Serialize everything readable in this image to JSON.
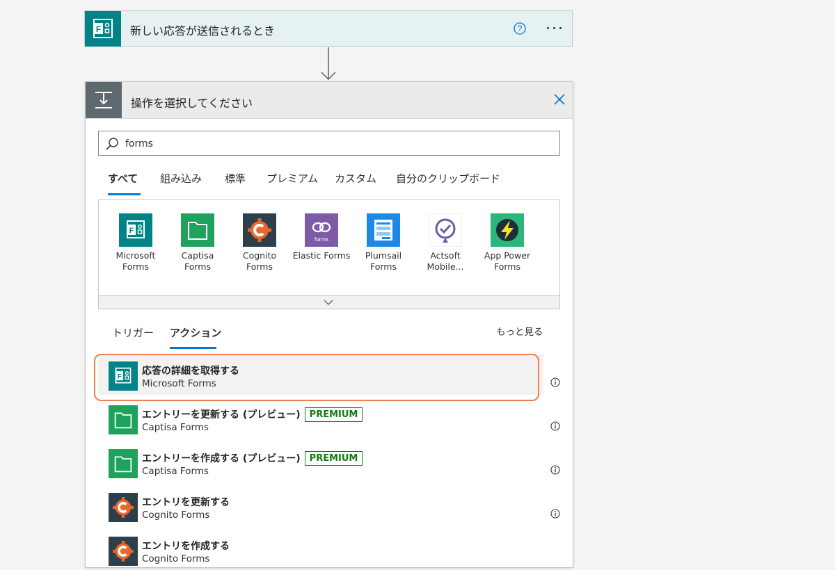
{
  "trigger": {
    "title": "新しい応答が送信されるとき",
    "icon": "microsoft-forms-icon",
    "help_icon": "help-circle-icon",
    "more_icon": "ellipsis-icon"
  },
  "picker": {
    "title": "操作を選択してください",
    "close_icon": "close-icon",
    "search": {
      "value": "forms",
      "icon": "search-icon"
    },
    "tabs": [
      {
        "label": "すべて",
        "active": true
      },
      {
        "label": "組み込み"
      },
      {
        "label": "標準"
      },
      {
        "label": "プレミアム"
      },
      {
        "label": "カスタム"
      },
      {
        "label": "自分のクリップボード"
      }
    ],
    "connectors": [
      {
        "label": "Microsoft Forms",
        "color": "#038387"
      },
      {
        "label": "Captisa Forms",
        "color": "#1fa35c"
      },
      {
        "label": "Cognito Forms",
        "color": "#2d3f4a"
      },
      {
        "label": "Elastic Forms",
        "color": "#7b5aa6"
      },
      {
        "label": "Plumsail Forms",
        "color": "#1e88e5"
      },
      {
        "label": "Actsoft Mobile...",
        "color": "#ffffff"
      },
      {
        "label": "App Power Forms",
        "color": "#2bb67b"
      }
    ],
    "sub_tabs": [
      {
        "label": "トリガー"
      },
      {
        "label": "アクション",
        "active": true
      }
    ],
    "see_more": "もっと見る",
    "actions": [
      {
        "name": "応答の詳細を取得する",
        "connector": "Microsoft Forms",
        "premium": "",
        "selected": true
      },
      {
        "name": "エントリーを更新する (プレビュー)",
        "connector": "Captisa Forms",
        "premium": "PREMIUM"
      },
      {
        "name": "エントリーを作成する (プレビュー)",
        "connector": "Captisa Forms",
        "premium": "PREMIUM"
      },
      {
        "name": "エントリを更新する",
        "connector": "Cognito Forms",
        "premium": ""
      },
      {
        "name": "エントリを作成する",
        "connector": "Cognito Forms",
        "premium": ""
      }
    ]
  },
  "colors": {
    "accent": "#0078d4",
    "premium": "#107c10",
    "highlight": "#f07f4b"
  }
}
